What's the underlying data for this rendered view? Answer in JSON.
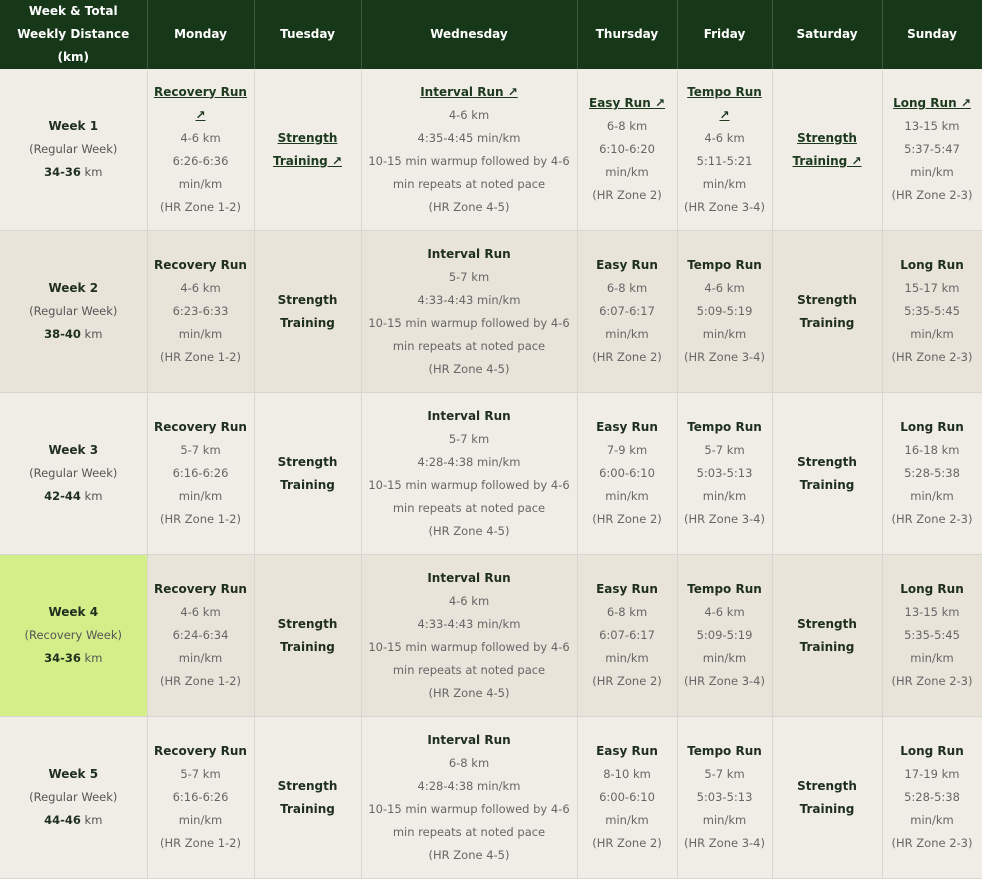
{
  "header": {
    "week": "Week & Total Weekly Distance (km)",
    "days": [
      "Monday",
      "Tuesday",
      "Wednesday",
      "Thursday",
      "Friday",
      "Saturday",
      "Sunday"
    ]
  },
  "link_arrow": "↗",
  "km_unit": "km",
  "weeks": [
    {
      "title": "Week 1",
      "type": "(Regular Week)",
      "distance": "34-36",
      "highlight": false,
      "monday": {
        "name": "Recovery Run",
        "link": true,
        "lines": [
          "4-6 km",
          "6:26-6:36",
          "min/km",
          "(HR Zone 1-2)"
        ]
      },
      "tuesday": {
        "name": "Strength Training",
        "link": true
      },
      "wednesday": {
        "name": "Interval Run",
        "link": true,
        "lines": [
          "4-6 km",
          "4:35-4:45 min/km",
          "10-15 min warmup followed by 4-6",
          "min repeats at noted pace",
          "(HR Zone 4-5)"
        ]
      },
      "thursday": {
        "name": "Easy Run",
        "link": true,
        "lines": [
          "6-8 km",
          "6:10-6:20",
          "min/km",
          "(HR Zone 2)"
        ]
      },
      "friday": {
        "name": "Tempo Run",
        "link": true,
        "lines": [
          "4-6 km",
          "5:11-5:21",
          "min/km",
          "(HR Zone 3-4)"
        ]
      },
      "saturday": {
        "name": "Strength Training",
        "link": true
      },
      "sunday": {
        "name": "Long Run",
        "link": true,
        "lines": [
          "13-15 km",
          "5:37-5:47",
          "min/km",
          "(HR Zone 2-3)"
        ]
      }
    },
    {
      "title": "Week 2",
      "type": "(Regular Week)",
      "distance": "38-40",
      "highlight": false,
      "monday": {
        "name": "Recovery Run",
        "link": false,
        "lines": [
          "4-6 km",
          "6:23-6:33",
          "min/km",
          "(HR Zone 1-2)"
        ]
      },
      "tuesday": {
        "name": "Strength Training",
        "link": false
      },
      "wednesday": {
        "name": "Interval Run",
        "link": false,
        "lines": [
          "5-7 km",
          "4:33-4:43 min/km",
          "10-15 min warmup followed by 4-6",
          "min repeats at noted pace",
          "(HR Zone 4-5)"
        ]
      },
      "thursday": {
        "name": "Easy Run",
        "link": false,
        "lines": [
          "6-8 km",
          "6:07-6:17",
          "min/km",
          "(HR Zone 2)"
        ]
      },
      "friday": {
        "name": "Tempo Run",
        "link": false,
        "lines": [
          "4-6 km",
          "5:09-5:19",
          "min/km",
          "(HR Zone 3-4)"
        ]
      },
      "saturday": {
        "name": "Strength Training",
        "link": false
      },
      "sunday": {
        "name": "Long Run",
        "link": false,
        "lines": [
          "15-17 km",
          "5:35-5:45",
          "min/km",
          "(HR Zone 2-3)"
        ]
      }
    },
    {
      "title": "Week 3",
      "type": "(Regular Week)",
      "distance": "42-44",
      "highlight": false,
      "monday": {
        "name": "Recovery Run",
        "link": false,
        "lines": [
          "5-7 km",
          "6:16-6:26",
          "min/km",
          "(HR Zone 1-2)"
        ]
      },
      "tuesday": {
        "name": "Strength Training",
        "link": false
      },
      "wednesday": {
        "name": "Interval Run",
        "link": false,
        "lines": [
          "5-7 km",
          "4:28-4:38 min/km",
          "10-15 min warmup followed by 4-6",
          "min repeats at noted pace",
          "(HR Zone 4-5)"
        ]
      },
      "thursday": {
        "name": "Easy Run",
        "link": false,
        "lines": [
          "7-9 km",
          "6:00-6:10",
          "min/km",
          "(HR Zone 2)"
        ]
      },
      "friday": {
        "name": "Tempo Run",
        "link": false,
        "lines": [
          "5-7 km",
          "5:03-5:13",
          "min/km",
          "(HR Zone 3-4)"
        ]
      },
      "saturday": {
        "name": "Strength Training",
        "link": false
      },
      "sunday": {
        "name": "Long Run",
        "link": false,
        "lines": [
          "16-18 km",
          "5:28-5:38",
          "min/km",
          "(HR Zone 2-3)"
        ]
      }
    },
    {
      "title": "Week 4",
      "type": "(Recovery Week)",
      "distance": "34-36",
      "highlight": true,
      "monday": {
        "name": "Recovery Run",
        "link": false,
        "lines": [
          "4-6 km",
          "6:24-6:34",
          "min/km",
          "(HR Zone 1-2)"
        ]
      },
      "tuesday": {
        "name": "Strength Training",
        "link": false
      },
      "wednesday": {
        "name": "Interval Run",
        "link": false,
        "lines": [
          "4-6 km",
          "4:33-4:43 min/km",
          "10-15 min warmup followed by 4-6",
          "min repeats at noted pace",
          "(HR Zone 4-5)"
        ]
      },
      "thursday": {
        "name": "Easy Run",
        "link": false,
        "lines": [
          "6-8 km",
          "6:07-6:17",
          "min/km",
          "(HR Zone 2)"
        ]
      },
      "friday": {
        "name": "Tempo Run",
        "link": false,
        "lines": [
          "4-6 km",
          "5:09-5:19",
          "min/km",
          "(HR Zone 3-4)"
        ]
      },
      "saturday": {
        "name": "Strength Training",
        "link": false
      },
      "sunday": {
        "name": "Long Run",
        "link": false,
        "lines": [
          "13-15 km",
          "5:35-5:45",
          "min/km",
          "(HR Zone 2-3)"
        ]
      }
    },
    {
      "title": "Week 5",
      "type": "(Regular Week)",
      "distance": "44-46",
      "highlight": false,
      "monday": {
        "name": "Recovery Run",
        "link": false,
        "lines": [
          "5-7 km",
          "6:16-6:26",
          "min/km",
          "(HR Zone 1-2)"
        ]
      },
      "tuesday": {
        "name": "Strength Training",
        "link": false
      },
      "wednesday": {
        "name": "Interval Run",
        "link": false,
        "lines": [
          "6-8 km",
          "4:28-4:38 min/km",
          "10-15 min warmup followed by 4-6",
          "min repeats at noted pace",
          "(HR Zone 4-5)"
        ]
      },
      "thursday": {
        "name": "Easy Run",
        "link": false,
        "lines": [
          "8-10 km",
          "6:00-6:10",
          "min/km",
          "(HR Zone 2)"
        ]
      },
      "friday": {
        "name": "Tempo Run",
        "link": false,
        "lines": [
          "5-7 km",
          "5:03-5:13",
          "min/km",
          "(HR Zone 3-4)"
        ]
      },
      "saturday": {
        "name": "Strength Training",
        "link": false
      },
      "sunday": {
        "name": "Long Run",
        "link": false,
        "lines": [
          "17-19 km",
          "5:28-5:38",
          "min/km",
          "(HR Zone 2-3)"
        ]
      }
    }
  ]
}
